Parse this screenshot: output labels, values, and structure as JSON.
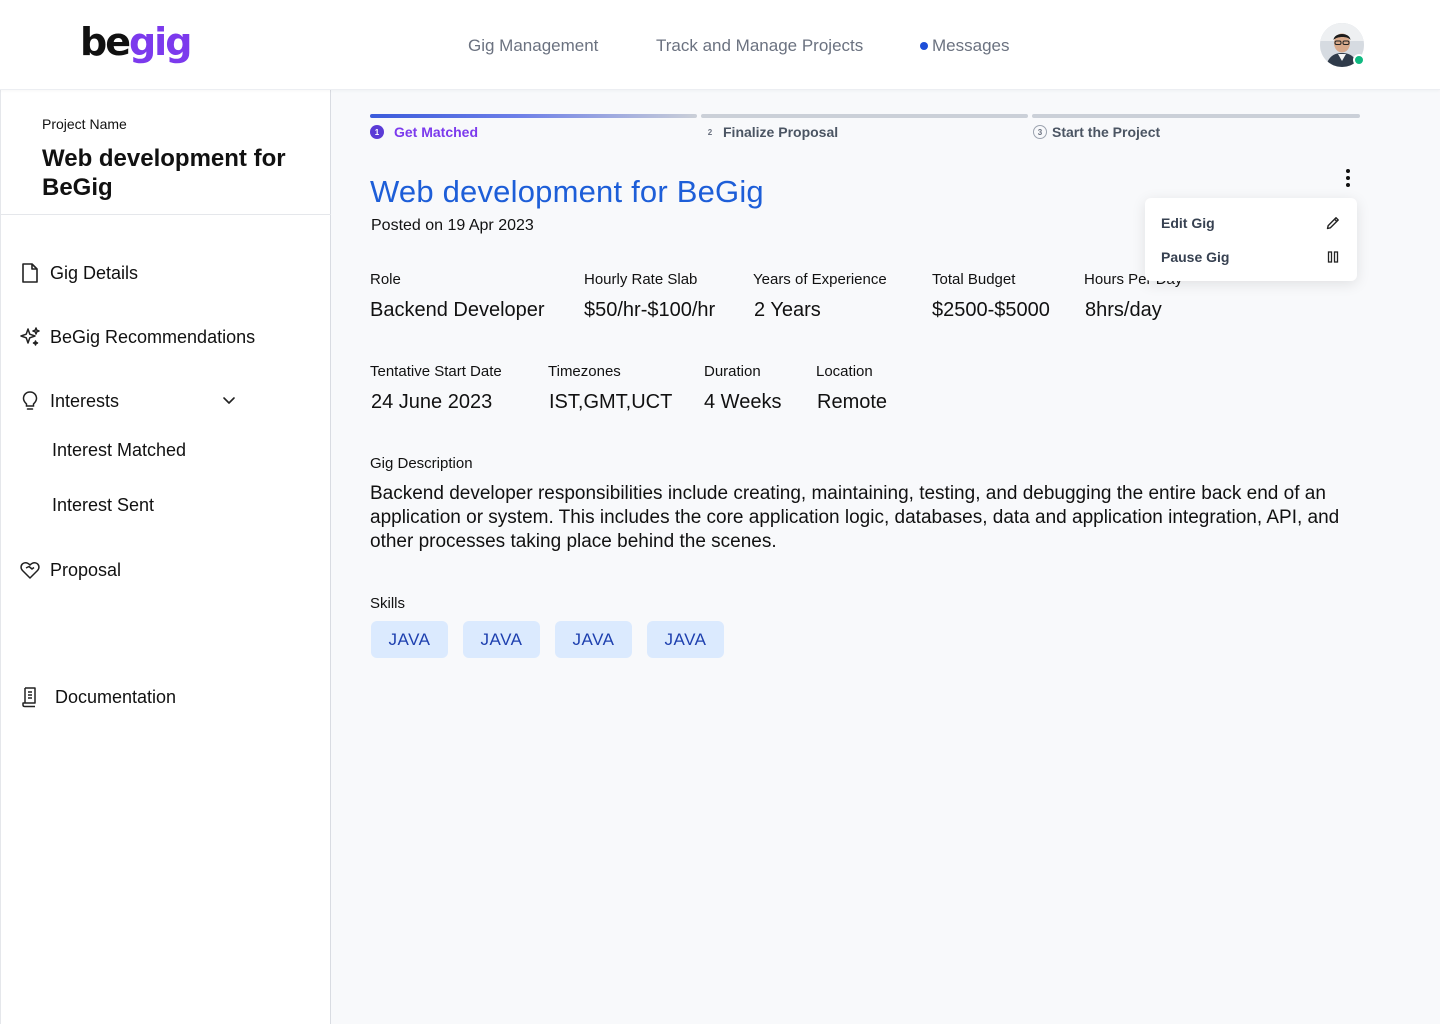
{
  "header": {
    "logo_be": "be",
    "logo_gig": "gig",
    "nav": [
      "Gig Management",
      "Track and Manage Projects",
      "Messages"
    ],
    "avatar_icon": "user-avatar"
  },
  "sidebar": {
    "project_label": "Project Name",
    "project_name": "Web development for BeGig",
    "items": {
      "gig_details": "Gig Details",
      "recommendations": "BeGig Recommendations",
      "interests": "Interests",
      "interest_matched": "Interest Matched",
      "interest_sent": "Interest Sent",
      "proposal": "Proposal",
      "documentation": "Documentation"
    }
  },
  "steps": [
    {
      "num": "1",
      "label": "Get Matched"
    },
    {
      "num": "2",
      "label": "Finalize Proposal"
    },
    {
      "num": "3",
      "label": "Start the Project"
    }
  ],
  "gig": {
    "title": "Web development for BeGig",
    "posted": "Posted on 19 Apr 2023",
    "fields": {
      "role": {
        "label": "Role",
        "value": "Backend Developer"
      },
      "rate": {
        "label": "Hourly Rate Slab",
        "value": "$50/hr-$100/hr"
      },
      "experience": {
        "label": "Years of Experience",
        "value": "2 Years"
      },
      "budget": {
        "label": "Total Budget",
        "value": "$2500-$5000"
      },
      "hours": {
        "label": "Hours Per Day",
        "value": "8hrs/day"
      },
      "start": {
        "label": "Tentative Start Date",
        "value": "24 June 2023"
      },
      "timezones": {
        "label": "Timezones",
        "value": "IST,GMT,UCT"
      },
      "duration": {
        "label": "Duration",
        "value": "4 Weeks"
      },
      "location": {
        "label": "Location",
        "value": "Remote"
      }
    },
    "description_label": "Gig Description",
    "description": "Backend developer responsibilities include creating, maintaining, testing, and debugging the entire back end of an application or system. This includes the core application logic, databases, data and application integration, API, and other processes taking place behind the scenes.",
    "skills_label": "Skills",
    "skills": [
      "JAVA",
      "JAVA",
      "JAVA",
      "JAVA"
    ]
  },
  "menu": {
    "edit": "Edit Gig",
    "pause": "Pause Gig"
  },
  "colors": {
    "accent": "#1d5ed8",
    "brand": "#7c3aed",
    "chip_bg": "#dbeafe",
    "online": "#10b981"
  }
}
